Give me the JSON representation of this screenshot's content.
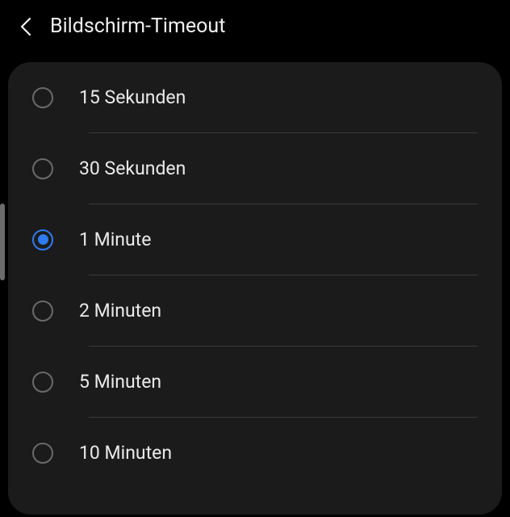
{
  "header": {
    "title": "Bildschirm-Timeout"
  },
  "options": [
    {
      "label": "15 Sekunden",
      "selected": false
    },
    {
      "label": "30 Sekunden",
      "selected": false
    },
    {
      "label": "1 Minute",
      "selected": true
    },
    {
      "label": "2 Minuten",
      "selected": false
    },
    {
      "label": "5 Minuten",
      "selected": false
    },
    {
      "label": "10 Minuten",
      "selected": false
    }
  ]
}
